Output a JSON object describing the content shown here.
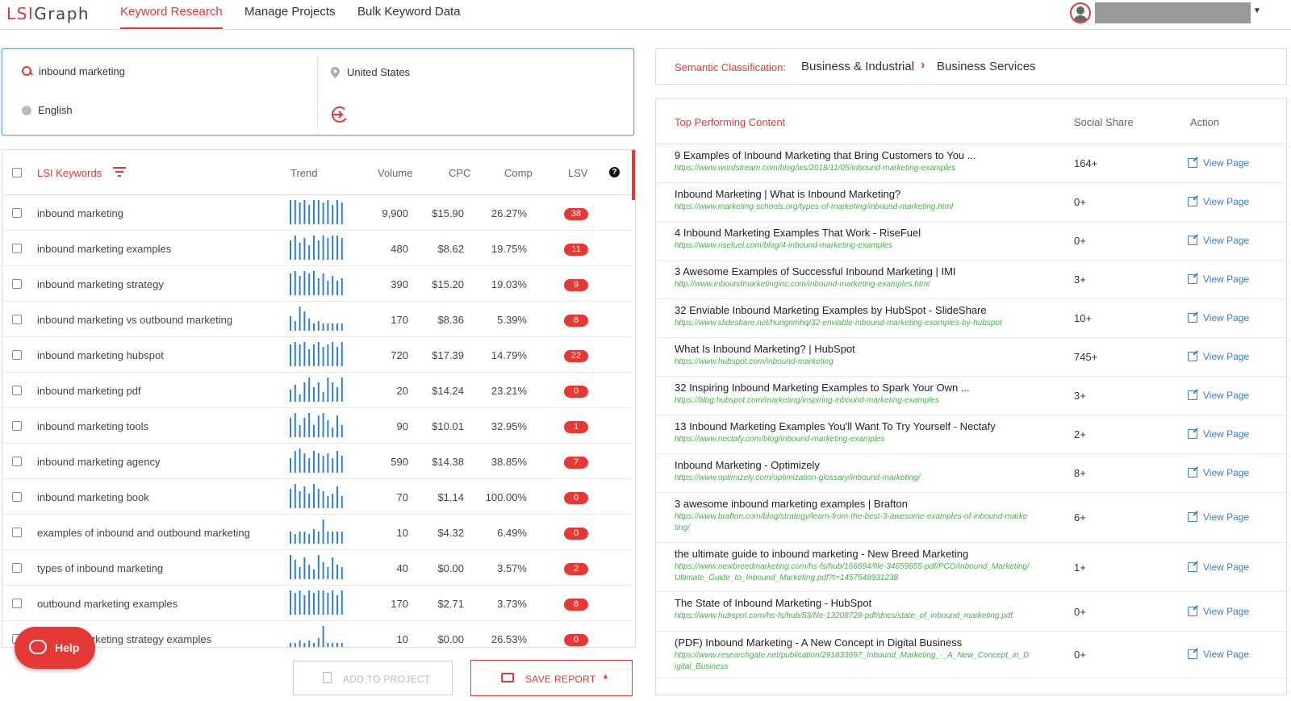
{
  "header": {
    "logo_prefix": "LSI",
    "logo_suffix": "Graph",
    "nav": [
      {
        "label": "Keyword Research",
        "active": true
      },
      {
        "label": "Manage Projects",
        "active": false
      },
      {
        "label": "Bulk Keyword Data",
        "active": false
      }
    ]
  },
  "search": {
    "keyword": "inbound marketing",
    "location": "United States",
    "language": "English"
  },
  "keywords_table": {
    "headers": {
      "keyword": "LSI Keywords",
      "trend": "Trend",
      "volume": "Volume",
      "cpc": "CPC",
      "comp": "Comp",
      "lsv": "LSV"
    },
    "rows": [
      {
        "keyword": "inbound marketing",
        "volume": "9,900",
        "cpc": "$15.90",
        "comp": "26.27%",
        "lsv": "38",
        "trend": [
          10,
          10,
          9,
          10,
          8,
          10,
          10,
          9,
          10,
          8,
          10,
          9
        ]
      },
      {
        "keyword": "inbound marketing examples",
        "volume": "480",
        "cpc": "$8.62",
        "comp": "19.75%",
        "lsv": "11",
        "trend": [
          8,
          10,
          7,
          9,
          6,
          10,
          8,
          10,
          9,
          10,
          10,
          9
        ]
      },
      {
        "keyword": "inbound marketing strategy",
        "volume": "390",
        "cpc": "$15.20",
        "comp": "19.03%",
        "lsv": "9",
        "trend": [
          9,
          10,
          8,
          10,
          9,
          10,
          7,
          9,
          6,
          8,
          6,
          7
        ]
      },
      {
        "keyword": "inbound marketing vs outbound marketing",
        "volume": "170",
        "cpc": "$8.36",
        "comp": "5.39%",
        "lsv": "8",
        "trend": [
          6,
          4,
          10,
          8,
          5,
          3,
          4,
          3,
          3,
          3,
          3,
          3
        ]
      },
      {
        "keyword": "inbound marketing hubspot",
        "volume": "720",
        "cpc": "$17.39",
        "comp": "14.79%",
        "lsv": "22",
        "trend": [
          9,
          10,
          9,
          10,
          7,
          9,
          10,
          8,
          9,
          10,
          8,
          10
        ]
      },
      {
        "keyword": "inbound marketing pdf",
        "volume": "20",
        "cpc": "$14.24",
        "comp": "23.21%",
        "lsv": "0",
        "trend": [
          5,
          7,
          3,
          8,
          10,
          6,
          8,
          4,
          10,
          8,
          6,
          10
        ]
      },
      {
        "keyword": "inbound marketing tools",
        "volume": "90",
        "cpc": "$10.01",
        "comp": "32.95%",
        "lsv": "1",
        "trend": [
          8,
          10,
          5,
          8,
          10,
          5,
          9,
          10,
          7,
          4,
          9,
          5
        ]
      },
      {
        "keyword": "inbound marketing agency",
        "volume": "590",
        "cpc": "$14.38",
        "comp": "38.85%",
        "lsv": "7",
        "trend": [
          6,
          9,
          10,
          8,
          6,
          9,
          8,
          7,
          8,
          6,
          9,
          7
        ]
      },
      {
        "keyword": "inbound marketing book",
        "volume": "70",
        "cpc": "$1.14",
        "comp": "100.00%",
        "lsv": "0",
        "trend": [
          8,
          10,
          7,
          9,
          6,
          10,
          8,
          7,
          5,
          6,
          9,
          5
        ]
      },
      {
        "keyword": "examples of inbound and outbound marketing",
        "volume": "10",
        "cpc": "$4.32",
        "comp": "6.49%",
        "lsv": "0",
        "trend": [
          5,
          4,
          5,
          5,
          4,
          6,
          5,
          10,
          5,
          5,
          5,
          5
        ]
      },
      {
        "keyword": "types of inbound marketing",
        "volume": "40",
        "cpc": "$0.00",
        "comp": "3.57%",
        "lsv": "2",
        "trend": [
          10,
          8,
          5,
          9,
          6,
          4,
          10,
          7,
          5,
          9,
          6,
          5
        ]
      },
      {
        "keyword": "outbound marketing examples",
        "volume": "170",
        "cpc": "$2.71",
        "comp": "3.73%",
        "lsv": "8",
        "trend": [
          10,
          9,
          10,
          8,
          10,
          9,
          10,
          10,
          9,
          10,
          8,
          10
        ]
      },
      {
        "keyword": "inbound marketing strategy examples",
        "volume": "10",
        "cpc": "$0.00",
        "comp": "26.53%",
        "lsv": "0",
        "trend": [
          3,
          3,
          4,
          3,
          4,
          3,
          5,
          10,
          3,
          3,
          3,
          3
        ]
      }
    ]
  },
  "buttons": {
    "help": "Help",
    "add_to_project": "ADD TO PROJECT",
    "save_report": "SAVE REPORT"
  },
  "semantic": {
    "label": "Semantic Classification:",
    "category": "Business & Industrial",
    "subcategory": "Business Services"
  },
  "top_content": {
    "headers": {
      "title": "Top Performing Content",
      "share": "Social Share",
      "action": "Action"
    },
    "action_label": "View Page",
    "rows": [
      {
        "title": "9 Examples of Inbound Marketing that Bring Customers to You ...",
        "url": "https://www.wordstream.com/blog/ws/2018/11/05/inbound-marketing-examples",
        "share": "164+"
      },
      {
        "title": "Inbound Marketing | What is Inbound Marketing?",
        "url": "https://www.marketing-schools.org/types-of-marketing/inbound-marketing.html",
        "share": "0+"
      },
      {
        "title": "4 Inbound Marketing Examples That Work - RiseFuel",
        "url": "https://www.risefuel.com/blog/4-inbound-marketing-examples",
        "share": "0+"
      },
      {
        "title": "3 Awesome Examples of Successful Inbound Marketing | IMI",
        "url": "http://www.inboundmarketinginc.com/inbound-marketing-examples.html",
        "share": "3+"
      },
      {
        "title": "32 Enviable Inbound Marketing Examples by HubSpot - SlideShare",
        "url": "https://www.slideshare.net/hungnmhq/32-enviable-inbound-marketing-examples-by-hubspot",
        "share": "10+"
      },
      {
        "title": "What Is Inbound Marketing? | HubSpot",
        "url": "https://www.hubspot.com/inbound-marketing",
        "share": "745+"
      },
      {
        "title": "32 Inspiring Inbound Marketing Examples to Spark Your Own ...",
        "url": "https://blog.hubspot.com/marketing/inspiring-inbound-marketing-examples",
        "share": "3+"
      },
      {
        "title": "13 Inbound Marketing Examples You'll Want To Try Yourself - Nectafy",
        "url": "https://www.nectafy.com/blog/inbound-marketing-examples",
        "share": "2+"
      },
      {
        "title": "Inbound Marketing - Optimizely",
        "url": "https://www.optimizely.com/optimization-glossary/inbound-marketing/",
        "share": "8+"
      },
      {
        "title": "3 awesome inbound marketing examples | Brafton",
        "url": "https://www.brafton.com/blog/strategy/learn-from-the-best-3-awesome-examples-of-inbound-marketing/",
        "share": "6+"
      },
      {
        "title": "the ultimate guide to inbound marketing - New Breed Marketing",
        "url": "https://www.newbreedmarketing.com/hs-fs/hub/166694/file-34659855-pdf/PCO/Inbound_Marketing/Ultimate_Guide_to_Inbound_Marketing.pdf?t=1457548931238",
        "share": "1+"
      },
      {
        "title": "The State of Inbound Marketing - HubSpot",
        "url": "https://www.hubspot.com/hs-fs/hub/53/file-13208728-pdf/docs/state_of_inbound_marketing.pdf",
        "share": "0+"
      },
      {
        "title": "(PDF) Inbound Marketing - A New Concept in Digital Business",
        "url": "https://www.researchgate.net/publication/291833697_Inbound_Marketing_-_A_New_Concept_in_Digital_Business",
        "share": "0+"
      }
    ]
  },
  "colors": {
    "accent": "#e53935",
    "trend_bar": "#2f80d1",
    "url_green": "#4caf50",
    "link_blue": "#3b82c4"
  }
}
